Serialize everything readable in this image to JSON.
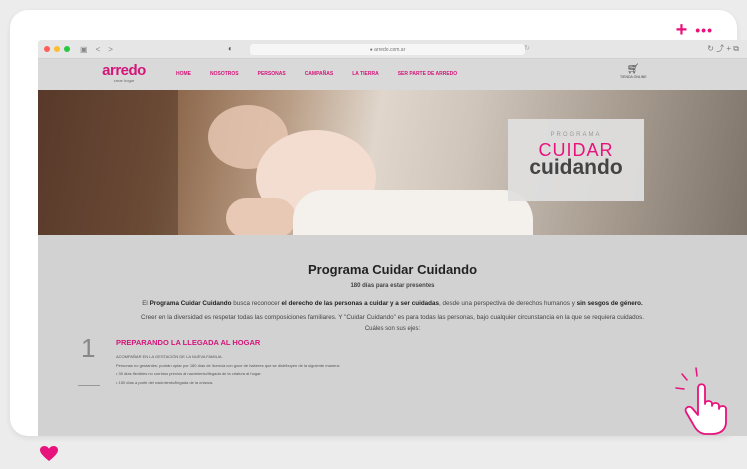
{
  "colors": {
    "accent": "#e8127c",
    "brand": "#d4157a"
  },
  "card": {
    "plus": "+",
    "more": "•••"
  },
  "browser": {
    "address": "● arredo.com.ar",
    "nav_back": "<",
    "nav_forward": ">",
    "right_icons": "↻ ⤴ + ⧉"
  },
  "site": {
    "logo": {
      "word": "arredo",
      "tagline": "crear hogar"
    },
    "nav": [
      "HOME",
      "NOSOTROS",
      "PERSONAS",
      "CAMPAÑAS",
      "LA TIERRA",
      "SER PARTE DE ARREDO"
    ],
    "store_label": "TIENDA ONLINE",
    "hero": {
      "pre": "PROGRAMA",
      "line1": "CUIDAR",
      "line2": "cuidando"
    },
    "title": "Programa Cuidar Cuidando",
    "subtitle": "180 días para estar presentes",
    "para": {
      "p1": "El ",
      "b1": "Programa Cuidar Cuidando",
      "p2": " busca reconocer ",
      "b2": "el derecho de las personas a cuidar y a ser cuidadas",
      "p3": ", desde una perspectiva de derechos humanos y ",
      "b3": "sin sesgos de género.",
      "p4": "Creer en la diversidad es respetar todas las composiciones familiares. Y \"Cuidar Cuidando\" es para todas las personas, bajo cualquier circunstancia en la que se requiera cuidados."
    },
    "ejes": "Cuáles son sus ejes:",
    "step": {
      "number": "1",
      "title": "PREPARANDO LA LLEGADA AL HOGAR",
      "lines": [
        "ACOMPAÑAR EN LA GESTACIÓN DE LA NUEVA FAMILIA.",
        "Personas no gestantes: podrán optar por 180 días de licencia con goce de haberes que se distribuyen de la siguiente manera:",
        "• 30 días flexibles no corridos previos al nacimiento/llegada de la criatura al hogar.",
        "• 150 días a partir del nacimiento/llegada de la crianza."
      ]
    }
  }
}
